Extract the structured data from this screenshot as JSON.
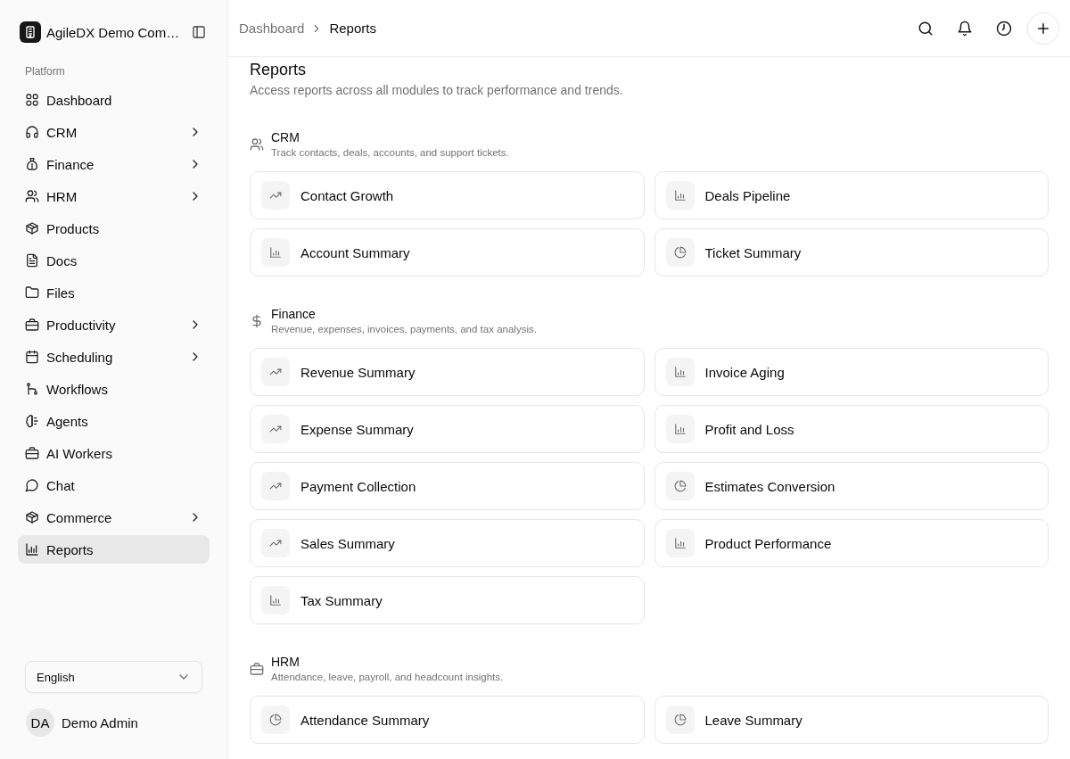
{
  "sidebar": {
    "workspace": {
      "name": "AgileDX Demo Com…"
    },
    "group_label": "Platform",
    "items": [
      {
        "label": "Dashboard",
        "expandable": false,
        "selected": false
      },
      {
        "label": "CRM",
        "expandable": true,
        "selected": false
      },
      {
        "label": "Finance",
        "expandable": true,
        "selected": false
      },
      {
        "label": "HRM",
        "expandable": true,
        "selected": false
      },
      {
        "label": "Products",
        "expandable": false,
        "selected": false
      },
      {
        "label": "Docs",
        "expandable": false,
        "selected": false
      },
      {
        "label": "Files",
        "expandable": false,
        "selected": false
      },
      {
        "label": "Productivity",
        "expandable": true,
        "selected": false
      },
      {
        "label": "Scheduling",
        "expandable": true,
        "selected": false
      },
      {
        "label": "Workflows",
        "expandable": false,
        "selected": false
      },
      {
        "label": "Agents",
        "expandable": false,
        "selected": false
      },
      {
        "label": "AI Workers",
        "expandable": false,
        "selected": false
      },
      {
        "label": "Chat",
        "expandable": false,
        "selected": false
      },
      {
        "label": "Commerce",
        "expandable": true,
        "selected": false
      },
      {
        "label": "Reports",
        "expandable": false,
        "selected": true
      }
    ],
    "language": {
      "value": "English"
    },
    "user": {
      "initials": "DA",
      "name": "Demo Admin"
    }
  },
  "header": {
    "breadcrumb": [
      "Dashboard",
      "Reports"
    ]
  },
  "page": {
    "title": "Reports",
    "subtitle": "Access reports across all modules to track performance and trends."
  },
  "sections": [
    {
      "name": "CRM",
      "description": "Track contacts, deals, accounts, and support tickets.",
      "reports": [
        {
          "title": "Contact Growth",
          "kind": "trend"
        },
        {
          "title": "Deals Pipeline",
          "kind": "bar"
        },
        {
          "title": "Account Summary",
          "kind": "bar"
        },
        {
          "title": "Ticket Summary",
          "kind": "pie"
        }
      ]
    },
    {
      "name": "Finance",
      "description": "Revenue, expenses, invoices, payments, and tax analysis.",
      "reports": [
        {
          "title": "Revenue Summary",
          "kind": "trend"
        },
        {
          "title": "Invoice Aging",
          "kind": "bar"
        },
        {
          "title": "Expense Summary",
          "kind": "trend"
        },
        {
          "title": "Profit and Loss",
          "kind": "bar"
        },
        {
          "title": "Payment Collection",
          "kind": "trend"
        },
        {
          "title": "Estimates Conversion",
          "kind": "pie"
        },
        {
          "title": "Sales Summary",
          "kind": "trend"
        },
        {
          "title": "Product Performance",
          "kind": "bar"
        },
        {
          "title": "Tax Summary",
          "kind": "bar"
        }
      ]
    },
    {
      "name": "HRM",
      "description": "Attendance, leave, payroll, and headcount insights.",
      "reports": [
        {
          "title": "Attendance Summary",
          "kind": "pie"
        },
        {
          "title": "Leave Summary",
          "kind": "pie"
        }
      ]
    }
  ]
}
